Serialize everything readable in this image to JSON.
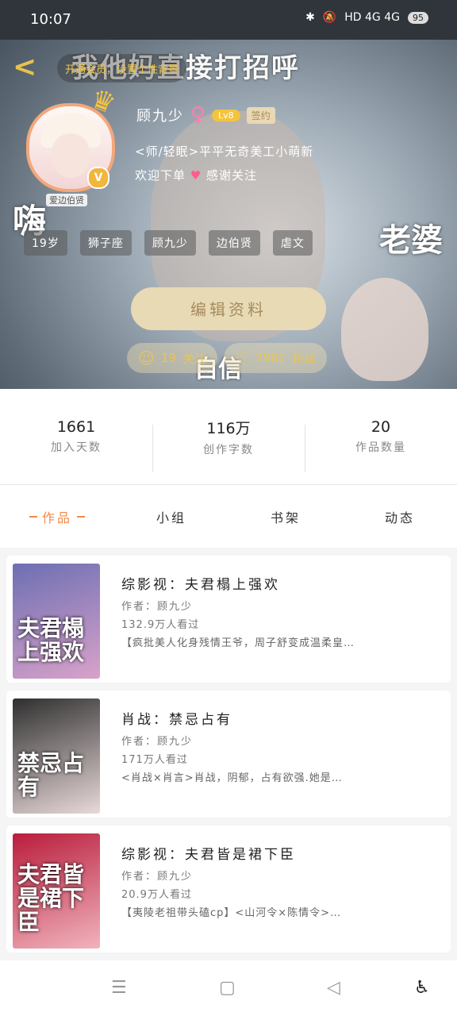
{
  "status": {
    "time": "10:07",
    "battery": "95",
    "network": "HD 4G 4G"
  },
  "header": {
    "meme_top": "我他妈直接打招呼",
    "meme_hi": "嗨",
    "meme_wife": "老婆",
    "meme_confident": "自信",
    "sub_banner": "开通会员，设置个性背景",
    "avatar_tag": "爱边伯贤",
    "name": "顾九少",
    "level": "Lv8",
    "sign_label": "签约",
    "bio_line1": "<师/轻眠>平平无奇美工小萌新",
    "bio_line2": "欢迎下单",
    "bio_line3": "感谢关注",
    "tags": [
      "19岁",
      "狮子座",
      "顾九少",
      "边伯贤",
      "虐文"
    ],
    "edit_label": "编辑资料",
    "follow_count": "19",
    "follow_label": "关注",
    "fans_count": "2982",
    "fans_label": "粉丝"
  },
  "stats": [
    {
      "num": "1661",
      "label": "加入天数"
    },
    {
      "num": "116万",
      "label": "创作字数"
    },
    {
      "num": "20",
      "label": "作品数量"
    }
  ],
  "tabs": [
    {
      "label": "作品",
      "active": true
    },
    {
      "label": "小组"
    },
    {
      "label": "书架"
    },
    {
      "label": "动态"
    }
  ],
  "books": [
    {
      "title": "综影视：夫君榻上强欢",
      "author": "作者：顾九少",
      "views": "132.9万人看过",
      "desc": "【疯批美人化身残情王爷，周子舒变成温柔皇…",
      "cover_text": "夫君榻上强欢",
      "cover_colors": [
        "#6d6fb3",
        "#d8a2c9"
      ]
    },
    {
      "title": "肖战：禁忌占有",
      "author": "作者：顾九少",
      "views": "171万人看过",
      "desc": "<肖战×肖言>肖战，阴郁，占有欲强.她是…",
      "cover_text": "禁忌占有",
      "cover_colors": [
        "#2f2f2f",
        "#e9d9d9"
      ]
    },
    {
      "title": "综影视：夫君皆是裙下臣",
      "author": "作者：顾九少",
      "views": "20.9万人看过",
      "desc": "【夷陵老祖带头磕cp】<山河令×陈情令>…",
      "cover_text": "夫君皆是裙下臣",
      "cover_colors": [
        "#b91d3c",
        "#f1b3bd"
      ]
    }
  ]
}
